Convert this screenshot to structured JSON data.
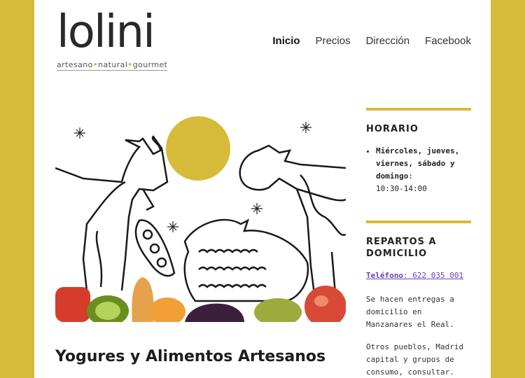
{
  "logo": {
    "word": "lolini",
    "tagline": [
      "artesano",
      "natural",
      "gourmet"
    ]
  },
  "nav": {
    "items": [
      "Inicio",
      "Precios",
      "Dirección",
      "Facebook"
    ],
    "active": "Inicio"
  },
  "post": {
    "title": "Yogures y Alimentos Artesanos"
  },
  "sidebar": {
    "horario": {
      "title": "HORARIO",
      "days": "Miércoles, jueves, viernes, sábado y domingo",
      "hours": "10:30-14:00"
    },
    "repartos": {
      "title": "REPARTOS A DOMICILIO",
      "phone_label": "Teléfono",
      "phone_number": ": 622 035 001",
      "text1": "Se hacen entregas a domicilio en Manzanares el Real.",
      "text2": "Otros pueblos, Madrid capital y grupos de consumo, consultar."
    }
  },
  "colors": {
    "accent": "#d6bb3a",
    "link": "#6b3fc0"
  }
}
